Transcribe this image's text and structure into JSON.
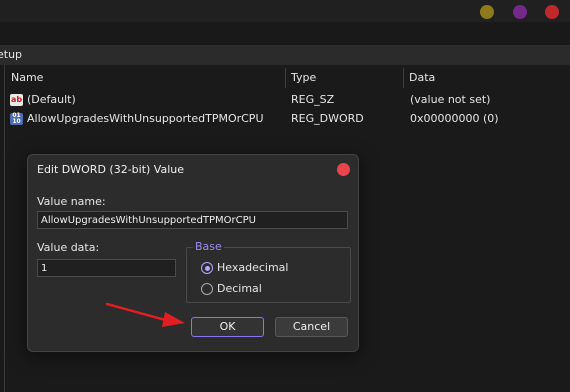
{
  "window": {
    "path_fragment": "etup",
    "controls": [
      {
        "name": "window-minimize-dot",
        "color": "#8e7a1c"
      },
      {
        "name": "window-maximize-dot",
        "color": "#74288a"
      },
      {
        "name": "window-close-dot",
        "color": "#c0282c"
      }
    ]
  },
  "list": {
    "columns": [
      "Name",
      "Type",
      "Data"
    ],
    "rows": [
      {
        "icon": "string-value-icon",
        "name": "(Default)",
        "type": "REG_SZ",
        "data": "(value not set)"
      },
      {
        "icon": "binary-value-icon",
        "name": "AllowUpgradesWithUnsupportedTPMOrCPU",
        "type": "REG_DWORD",
        "data": "0x00000000 (0)"
      }
    ]
  },
  "dialog": {
    "title": "Edit DWORD (32-bit) Value",
    "value_name_label": "Value name:",
    "value_name": "AllowUpgradesWithUnsupportedTPMOrCPU",
    "value_data_label": "Value data:",
    "value_data": "1",
    "base_label": "Base",
    "base_options": [
      {
        "label": "Hexadecimal",
        "checked": true
      },
      {
        "label": "Decimal",
        "checked": false
      }
    ],
    "ok_label": "OK",
    "cancel_label": "Cancel"
  },
  "annotation": {
    "arrow_color": "#e01e24"
  }
}
